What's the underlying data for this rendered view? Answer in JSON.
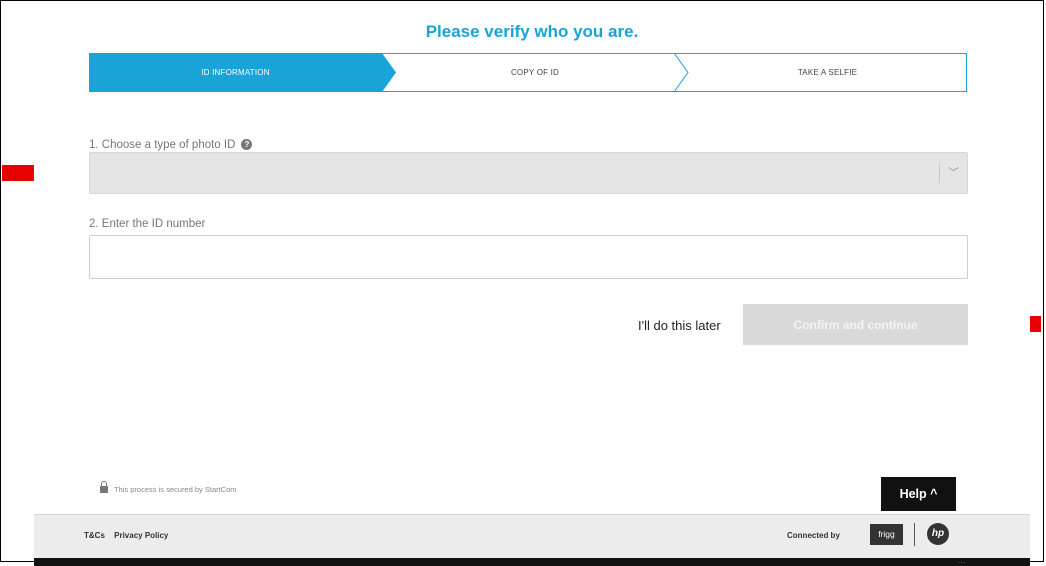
{
  "title": "Please verify who you are.",
  "steps": [
    {
      "label": "ID INFORMATION",
      "active": true
    },
    {
      "label": "COPY OF ID",
      "active": false
    },
    {
      "label": "TAKE A SELFIE",
      "active": false
    }
  ],
  "form": {
    "id_type_label": "1. Choose a type of photo ID",
    "id_type_help": "?",
    "id_type_value": "",
    "id_number_label": "2. Enter the ID number",
    "id_number_value": ""
  },
  "actions": {
    "later_label": "I'll do this later",
    "confirm_label": "Confirm and continue"
  },
  "secure_text": "This process is secured by StartCom",
  "help_label": "Help ^",
  "footer": {
    "tcs": "T&Cs",
    "privacy": "Privacy Policy",
    "connected_by": "Connected by",
    "frigg_logo": "frigg",
    "hp_logo": "hp"
  },
  "system_tray": "...",
  "colors": {
    "accent": "#19a3d6",
    "annotation_arrow": "#e60000",
    "disabled_button": "#d9d9d9",
    "help_bg": "#111111"
  },
  "icons": {
    "lock": "lock-icon",
    "chevron": "chevron-down-icon",
    "help_caret": "caret-up-icon"
  }
}
